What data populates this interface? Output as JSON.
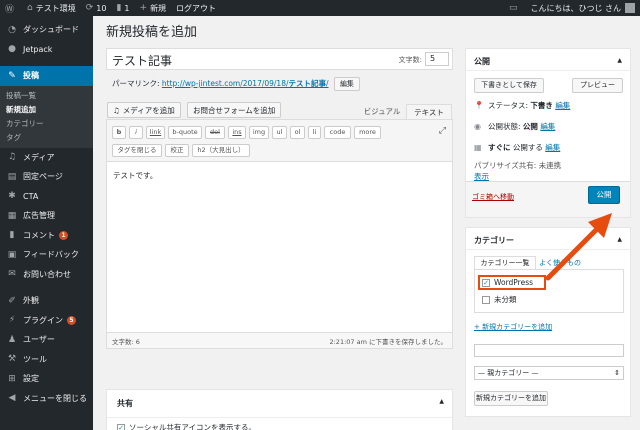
{
  "adminbar": {
    "site_name": "テスト環境",
    "updates_count": "10",
    "comments_count": "1",
    "new_label": "新規",
    "logout_label": "ログアウト",
    "greeting": "こんにちは、ひつじ さん"
  },
  "sidebar": {
    "items": [
      {
        "label": "ダッシュボード",
        "icon": "dashboard-icon"
      },
      {
        "label": "Jetpack",
        "icon": "jetpack-icon"
      },
      {
        "label": "投稿",
        "icon": "pin-icon"
      },
      {
        "label": "メディア",
        "icon": "media-icon"
      },
      {
        "label": "固定ページ",
        "icon": "page-icon"
      },
      {
        "label": "CTA",
        "icon": "cta-icon"
      },
      {
        "label": "広告管理",
        "icon": "ad-icon"
      },
      {
        "label": "コメント",
        "icon": "comment-icon",
        "badge": "1"
      },
      {
        "label": "フィードバック",
        "icon": "feedback-icon"
      },
      {
        "label": "お問い合わせ",
        "icon": "mail-icon"
      },
      {
        "label": "外観",
        "icon": "brush-icon"
      },
      {
        "label": "プラグイン",
        "icon": "plugin-icon",
        "badge": "5"
      },
      {
        "label": "ユーザー",
        "icon": "user-icon"
      },
      {
        "label": "ツール",
        "icon": "wrench-icon"
      },
      {
        "label": "設定",
        "icon": "settings-icon"
      },
      {
        "label": "メニューを閉じる",
        "icon": "collapse-icon"
      }
    ],
    "submenu": [
      "投稿一覧",
      "新規追加",
      "カテゴリー",
      "タグ"
    ]
  },
  "page": {
    "title": "新規投稿を追加",
    "post_title": "テスト記事",
    "word_count_label": "文字数:",
    "word_count_value": "5",
    "permalink_label": "パーマリンク:",
    "permalink_url": "http://wp-jintest.com/2017/09/18/",
    "permalink_slug": "テスト記事",
    "permalink_suffix": "/",
    "edit_label": "編集"
  },
  "editor": {
    "add_media": "メディアを追加",
    "add_form": "お問合せフォームを追加",
    "tab_visual": "ビジュアル",
    "tab_text": "テキスト",
    "buttons": [
      "b",
      "i",
      "link",
      "b-quote",
      "del",
      "ins",
      "img",
      "ul",
      "ol",
      "li",
      "code",
      "more",
      "タグを閉じる",
      "校正",
      "h2（大見出し）"
    ],
    "content": "テストです。",
    "footer_count": "文字数: 6",
    "footer_saved": "2:21:07 am に下書きを保存しました。"
  },
  "share": {
    "title": "共有",
    "option": "ソーシャル共有アイコンを表示する。"
  },
  "publish": {
    "title": "公開",
    "save_draft": "下書きとして保存",
    "preview": "プレビュー",
    "status_label": "ステータス:",
    "status_value": "下書き",
    "visibility_label": "公開状態:",
    "visibility_value": "公開",
    "schedule_label": "すぐに",
    "schedule_suffix": "公開する",
    "edit": "編集",
    "publicize_label": "パブリサイズ共有: 未連携",
    "show_label": "表示",
    "trash": "ゴミ箱へ移動",
    "publish_btn": "公開"
  },
  "category": {
    "title": "カテゴリー",
    "tab_all": "カテゴリー一覧",
    "tab_popular": "よく使うもの",
    "items": [
      {
        "label": "WordPress",
        "checked": true
      },
      {
        "label": "未分類",
        "checked": false
      }
    ],
    "add_new_link": "+ 新規カテゴリーを追加",
    "parent_select": "— 親カテゴリー —",
    "add_button": "新規カテゴリーを追加"
  },
  "colors": {
    "admin_bg": "#23282d",
    "active_blue": "#0073aa",
    "publish_blue": "#0085ba",
    "annotation_red": "#e74c0f"
  }
}
